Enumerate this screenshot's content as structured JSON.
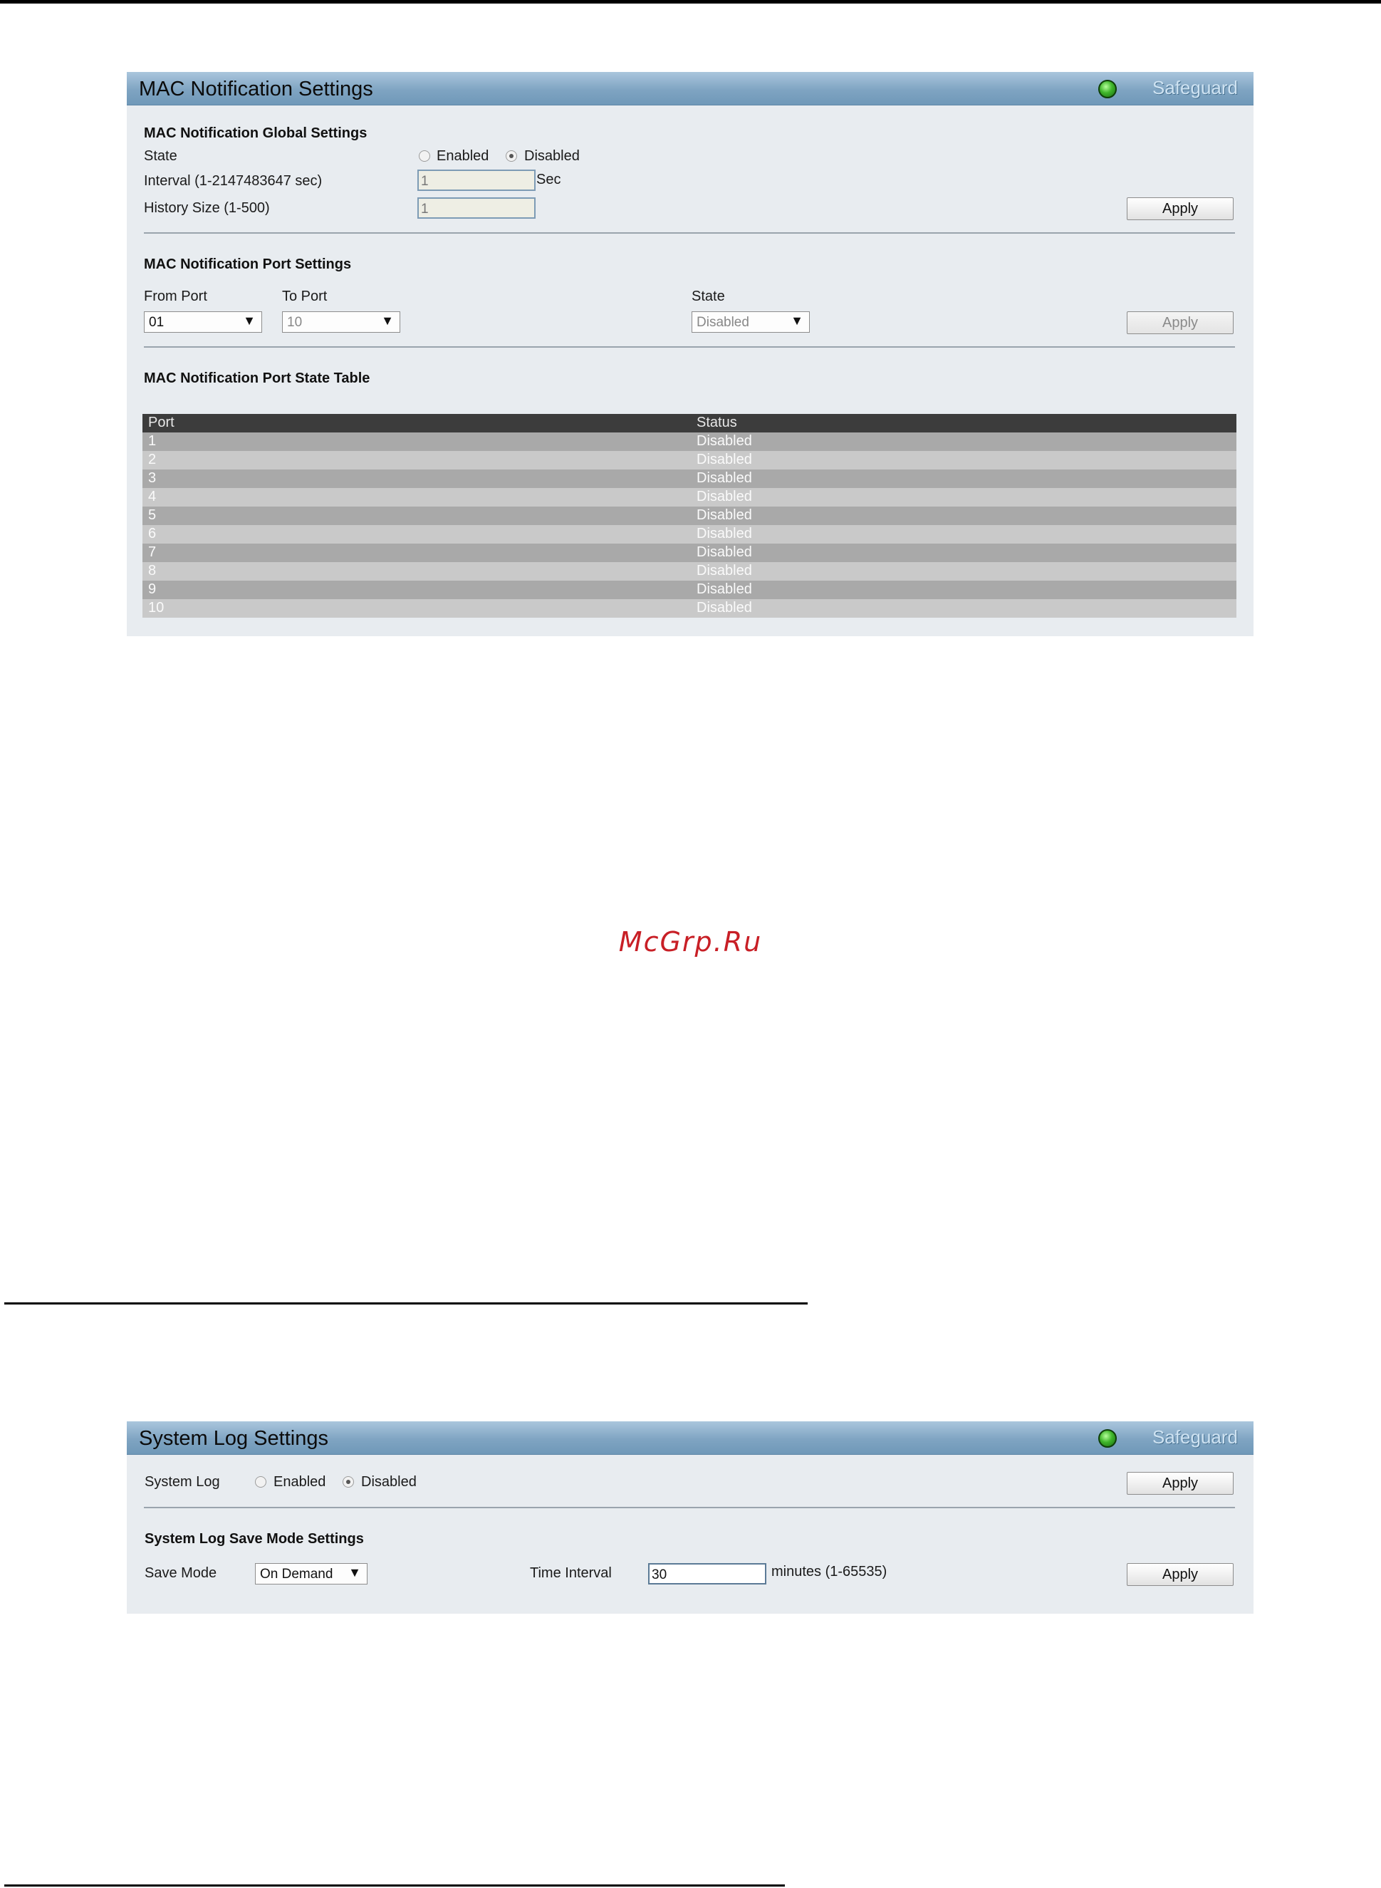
{
  "mac_panel": {
    "title": "MAC Notification Settings",
    "badge": "Safeguard",
    "global": {
      "title": "MAC Notification Global Settings",
      "state_label": "State",
      "enabled_label": "Enabled",
      "disabled_label": "Disabled",
      "selected_state": "Disabled",
      "interval_label": "Interval (1-2147483647 sec)",
      "interval_value": "1",
      "interval_unit": "Sec",
      "history_label": "History Size (1-500)",
      "history_value": "1",
      "apply_label": "Apply"
    },
    "port_settings": {
      "title": "MAC Notification Port Settings",
      "from_port_label": "From Port",
      "from_port_value": "01",
      "to_port_label": "To Port",
      "to_port_value": "10",
      "state_label": "State",
      "state_value": "Disabled",
      "apply_label": "Apply"
    },
    "table": {
      "title": "MAC Notification Port State Table",
      "columns": [
        "Port",
        "Status"
      ],
      "rows": [
        [
          "1",
          "Disabled"
        ],
        [
          "2",
          "Disabled"
        ],
        [
          "3",
          "Disabled"
        ],
        [
          "4",
          "Disabled"
        ],
        [
          "5",
          "Disabled"
        ],
        [
          "6",
          "Disabled"
        ],
        [
          "7",
          "Disabled"
        ],
        [
          "8",
          "Disabled"
        ],
        [
          "9",
          "Disabled"
        ],
        [
          "10",
          "Disabled"
        ]
      ]
    }
  },
  "watermark": "McGrp.Ru",
  "syslog_panel": {
    "title": "System Log Settings",
    "badge": "Safeguard",
    "system_log_label": "System Log",
    "enabled_label": "Enabled",
    "disabled_label": "Disabled",
    "selected_state": "Disabled",
    "apply_label": "Apply",
    "save_mode_title": "System Log Save Mode Settings",
    "save_mode_label": "Save Mode",
    "save_mode_value": "On Demand",
    "time_interval_label": "Time Interval",
    "time_interval_value": "30",
    "time_interval_unit": "minutes (1-65535)",
    "apply2_label": "Apply"
  }
}
